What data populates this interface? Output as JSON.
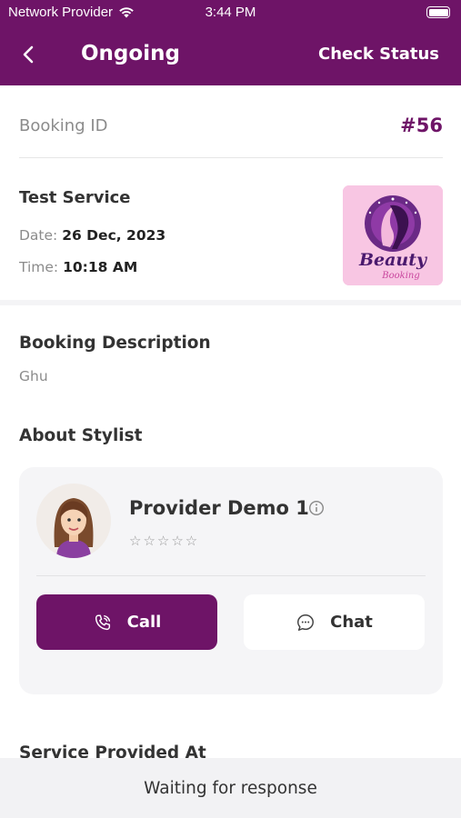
{
  "status_bar": {
    "carrier": "Network Provider",
    "time": "3:44 PM",
    "wifi_icon": "wifi-icon",
    "battery_icon": "battery-icon"
  },
  "header": {
    "title": "Ongoing",
    "action_label": "Check Status",
    "back_icon": "chevron-left-icon",
    "background_color": "#6e1467"
  },
  "booking": {
    "id_label": "Booking ID",
    "id_value": "#56"
  },
  "service": {
    "name": "Test Service",
    "date_label": "Date:",
    "date_value": "26 Dec, 2023",
    "time_label": "Time:",
    "time_value": "10:18 AM",
    "logo_text_1": "Beauty",
    "logo_text_2": "Booking"
  },
  "description": {
    "title": "Booking Description",
    "text": "Ghu"
  },
  "stylist": {
    "section_title": "About Stylist",
    "name": "Provider Demo 1",
    "rating": 0,
    "rating_max": 5,
    "stars": "☆☆☆☆☆",
    "call_label": "Call",
    "chat_label": "Chat",
    "call_icon": "phone-icon",
    "chat_icon": "chat-bubble-icon",
    "info_icon": "info-icon"
  },
  "service_provided_title": "Service Provided At",
  "footer": {
    "status_text": "Waiting for response"
  },
  "colors": {
    "accent": "#6e1467",
    "card_bg": "#f5f5f7",
    "muted_text": "#8b8b8b"
  }
}
